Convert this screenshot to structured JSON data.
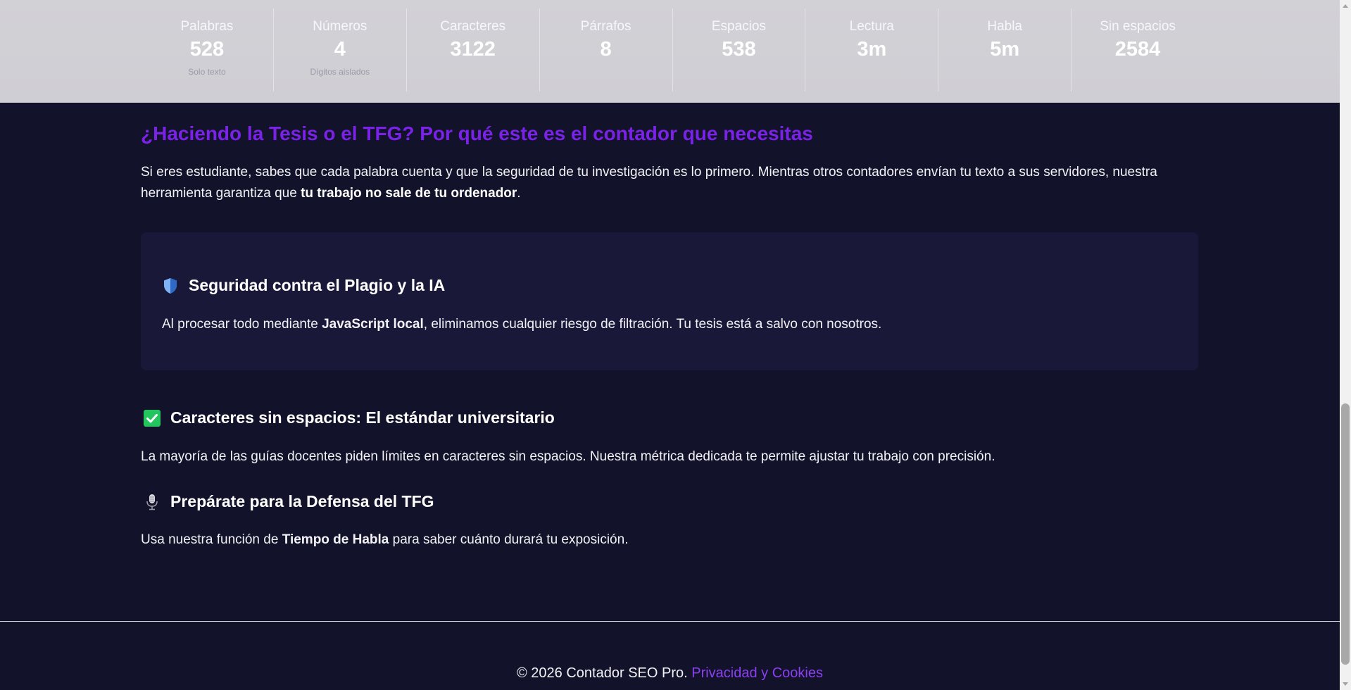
{
  "stats": [
    {
      "label": "Palabras",
      "value": "528",
      "note": "Solo texto"
    },
    {
      "label": "Números",
      "value": "4",
      "note": "Dígitos aislados"
    },
    {
      "label": "Caracteres",
      "value": "3122",
      "note": ""
    },
    {
      "label": "Párrafos",
      "value": "8",
      "note": ""
    },
    {
      "label": "Espacios",
      "value": "538",
      "note": ""
    },
    {
      "label": "Lectura",
      "value": "3m",
      "note": ""
    },
    {
      "label": "Habla",
      "value": "5m",
      "note": ""
    },
    {
      "label": "Sin espacios",
      "value": "2584",
      "note": ""
    }
  ],
  "content": {
    "title": "¿Haciendo la Tesis o el TFG? Por qué este es el contador que necesitas",
    "intro_text": "Si eres estudiante, sabes que cada palabra cuenta y que la seguridad de tu investigación es lo primero. Mientras otros contadores envían tu texto a sus servidores, nuestra herramienta garantiza que ",
    "intro_bold": "tu trabajo no sale de tu ordenador",
    "intro_end": ".",
    "card": {
      "icon": "shield-icon",
      "title": "Seguridad contra el Plagio y la IA",
      "text_before": "Al procesar todo mediante ",
      "text_bold": "JavaScript local",
      "text_after": ", eliminamos cualquier riesgo de filtración. Tu tesis está a salvo con nosotros."
    },
    "section1": {
      "icon": "check-mark-icon",
      "title": "Caracteres sin espacios: El estándar universitario",
      "text": "La mayoría de las guías docentes piden límites en caracteres sin espacios. Nuestra métrica dedicada te permite ajustar tu trabajo con precisión."
    },
    "section2": {
      "icon": "microphone-icon",
      "title": "Prepárate para la Defensa del TFG",
      "text_before": "Usa nuestra función de ",
      "text_bold": "Tiempo de Habla",
      "text_after": " para saber cuánto durará tu exposición."
    }
  },
  "footer": {
    "copyright": "© 2026 Contador SEO Pro.",
    "link_label": "Privacidad y Cookies"
  },
  "colors": {
    "background": "#12132b",
    "accent": "#7a22e8",
    "link": "#8b3ff2",
    "card": "#191839"
  }
}
